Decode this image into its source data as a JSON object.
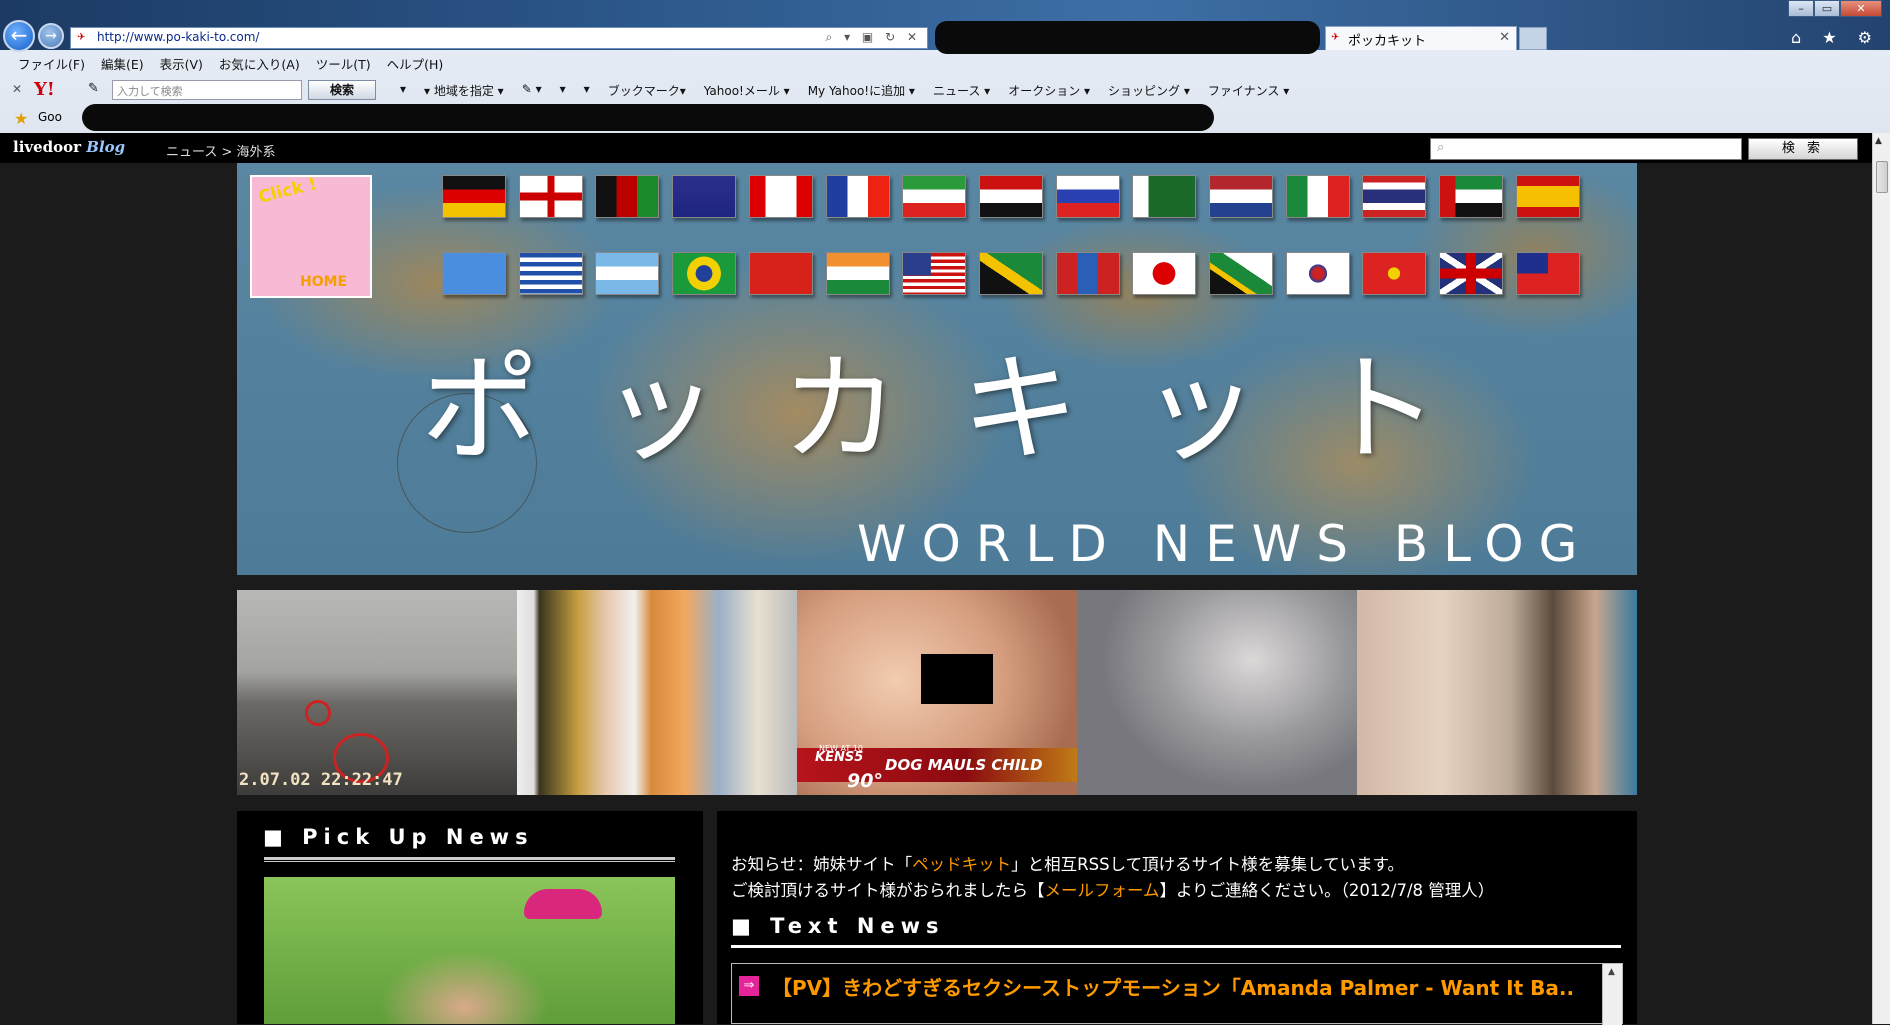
{
  "browser": {
    "url": "http://www.po-kaki-to.com/",
    "address_icons": "⌕ ▾ ▣ ↻ ✕",
    "tab_title": "ポッカキット",
    "tab_close": "✕",
    "window_buttons": {
      "minimize": "–",
      "maximize": "▭",
      "close": "✕"
    },
    "top_icons": "⌂ ★ ⚙",
    "menu": [
      "ファイル(F)",
      "編集(E)",
      "表示(V)",
      "お気に入り(A)",
      "ツール(T)",
      "ヘルプ(H)"
    ],
    "toolbar": {
      "close": "✕",
      "yahoo": "Y!",
      "search_placeholder": "入力して検索",
      "search_button": "検索",
      "items": [
        "▾",
        "▾ 地域を指定 ▾",
        "✎ ▾",
        "▾",
        "▾",
        "ブックマーク▾",
        "Yahoo!メール ▾",
        "My Yahoo!に追加 ▾",
        "ニュース ▾",
        "オークション ▾",
        "ショッピング ▾",
        "ファイナンス ▾"
      ]
    },
    "favorites": {
      "google": "Goo"
    }
  },
  "livedoor": {
    "logo": "livedoor",
    "logo_script": "Blog",
    "breadcrumb": "ニュース > 海外系",
    "search_button": "検 索",
    "search_icon": "magnifier-icon"
  },
  "banner": {
    "title": "ポッカキット",
    "subtitle": "WORLD NEWS BLOG",
    "logo_text_top": "Click !",
    "logo_text_bottom": "HOME",
    "flags_row1": [
      "germany",
      "england",
      "afghanistan",
      "australia",
      "canada",
      "france",
      "iran",
      "iraq",
      "russia",
      "pakistan",
      "netherlands",
      "italy",
      "thailand",
      "uae",
      "spain"
    ],
    "flags_row2": [
      "somalia",
      "greece",
      "argentina",
      "brazil",
      "china",
      "india",
      "usa",
      "jamaica",
      "mongolia",
      "japan",
      "south-africa",
      "south-korea",
      "vietnam",
      "uk",
      "taiwan"
    ]
  },
  "thumbnails": {
    "t1_timestamp": "2.07.02 22:22:47",
    "t3_station": "KENS5",
    "t3_newsat": "NEW AT 10",
    "t3_temp": "90°",
    "t3_caption": "DOG MAULS CHILD"
  },
  "pickup": {
    "title": "■ Pick Up News"
  },
  "notice": {
    "line1_pre": "お知らせ：姉妹サイト「",
    "line1_link": "ペッドキット",
    "line1_post": "」と相互RSSして頂けるサイト様を募集しています。",
    "line2_pre": "ご検討頂けるサイト様がおられましたら【",
    "line2_link": "メールフォーム",
    "line2_post": "】よりご連絡ください。（2012/7/8 管理人）"
  },
  "text_news": {
    "title": "■ Text News",
    "arrow": "⇒",
    "first_item": "【PV】きわどすぎるセクシーストップモーション「Amanda Palmer - Want It Ba.."
  },
  "colors": {
    "accent_link": "#ff9900",
    "page_bg": "#1b1b1b"
  }
}
